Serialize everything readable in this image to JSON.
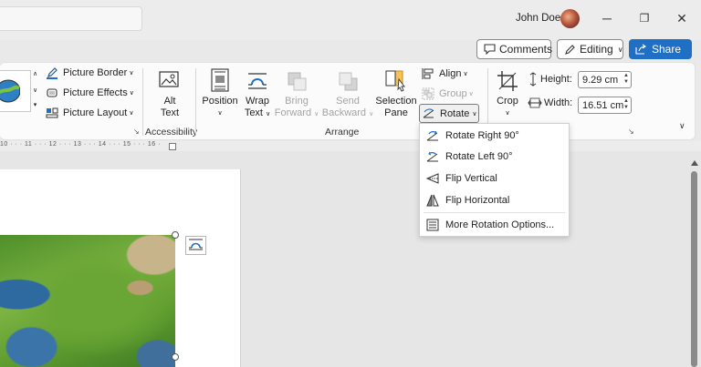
{
  "titlebar": {
    "user_name": "John Doe",
    "minimize": "─",
    "restore": "❐",
    "close": "✕"
  },
  "actions": {
    "comments": "Comments",
    "editing": "Editing",
    "share": "Share"
  },
  "ribbon": {
    "picture_border": "Picture Border",
    "picture_effects": "Picture Effects",
    "picture_layout": "Picture Layout",
    "alt_text_line1": "Alt",
    "alt_text_line2": "Text",
    "accessibility_label": "Accessibility",
    "position_label": "Position",
    "wrap_text_line1": "Wrap",
    "wrap_text_line2": "Text",
    "bring_forward_line1": "Bring",
    "bring_forward_line2": "Forward",
    "send_backward_line1": "Send",
    "send_backward_line2": "Backward",
    "selection_pane_line1": "Selection",
    "selection_pane_line2": "Pane",
    "align": "Align",
    "group": "Group",
    "rotate": "Rotate",
    "arrange_label": "Arrange",
    "crop": "Crop",
    "height_label": "Height:",
    "height_value": "9.29 cm",
    "width_label": "Width:",
    "width_value": "16.51 cm"
  },
  "ruler": {
    "ticks": "10 · · · 11 · · · 12 · · · 13 · · · 14 · · · 15 · · · 16 ·"
  },
  "rotate_menu": {
    "items": [
      {
        "label": "Rotate Right 90°"
      },
      {
        "label": "Rotate Left 90°"
      },
      {
        "label": "Flip Vertical"
      },
      {
        "label": "Flip Horizontal"
      },
      {
        "label": "More Rotation Options..."
      }
    ]
  },
  "colors": {
    "accent": "#1f6fc5",
    "ribbon_bg": "#fbfbfb",
    "menu_bg": "#ffffff"
  }
}
